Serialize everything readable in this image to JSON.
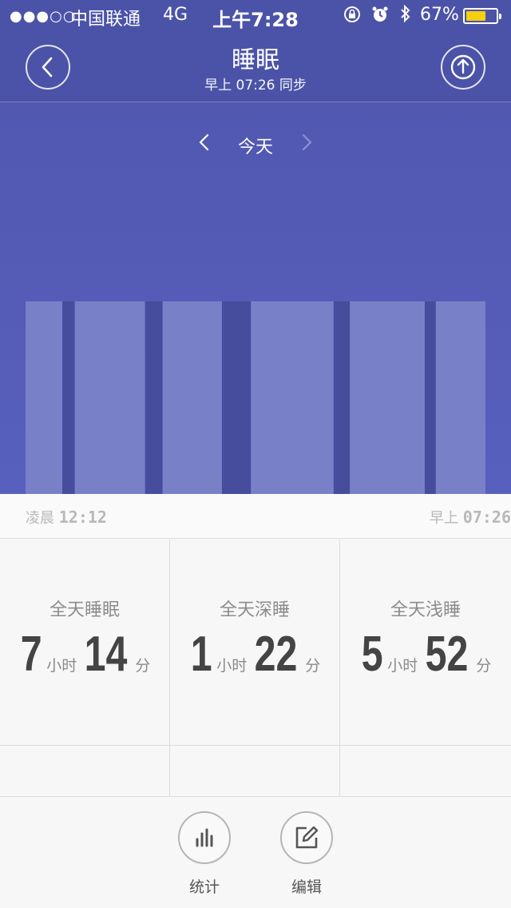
{
  "status_bar": {
    "signal": "●●●○○",
    "carrier": "中国联通",
    "network": "4G",
    "time": "上午7:28",
    "battery_percent": "67%",
    "battery_level": 0.67,
    "icons": [
      "rotation-lock-icon",
      "alarm-icon",
      "bluetooth-icon"
    ]
  },
  "header": {
    "title": "睡眠",
    "subtitle": "早上 07:26 同步"
  },
  "date_nav": {
    "label": "今天"
  },
  "chart_data": {
    "type": "bar",
    "description_segments": "sleep stages from start to end",
    "segments": [
      {
        "stage": "light",
        "start": 0.0,
        "end": 0.08
      },
      {
        "stage": "deep",
        "start": 0.08,
        "end": 0.107
      },
      {
        "stage": "light",
        "start": 0.107,
        "end": 0.26
      },
      {
        "stage": "deep",
        "start": 0.26,
        "end": 0.298
      },
      {
        "stage": "light",
        "start": 0.298,
        "end": 0.427
      },
      {
        "stage": "deep",
        "start": 0.427,
        "end": 0.49
      },
      {
        "stage": "light",
        "start": 0.49,
        "end": 0.67
      },
      {
        "stage": "deep",
        "start": 0.67,
        "end": 0.705
      },
      {
        "stage": "light",
        "start": 0.705,
        "end": 0.868
      },
      {
        "stage": "deep",
        "start": 0.868,
        "end": 0.892
      },
      {
        "stage": "light",
        "start": 0.892,
        "end": 1.0
      }
    ],
    "colors": {
      "light": "#7880c8",
      "deep": "#454d9c"
    }
  },
  "axis": {
    "start_prefix": "凌晨",
    "start_time": "12:12",
    "end_prefix": "早上",
    "end_time": "07:26"
  },
  "stats": [
    {
      "caption": "全天睡眠",
      "hours": "7",
      "hour_unit": "小时",
      "minutes": "14",
      "minute_unit": "分"
    },
    {
      "caption": "全天深睡",
      "hours": "1",
      "hour_unit": "小时",
      "minutes": "22",
      "minute_unit": "分"
    },
    {
      "caption": "全天浅睡",
      "hours": "5",
      "hour_unit": "小时",
      "minutes": "52",
      "minute_unit": "分"
    }
  ],
  "actions": [
    {
      "label": "统计",
      "icon": "bar-chart-icon"
    },
    {
      "label": "编辑",
      "icon": "edit-icon"
    }
  ]
}
